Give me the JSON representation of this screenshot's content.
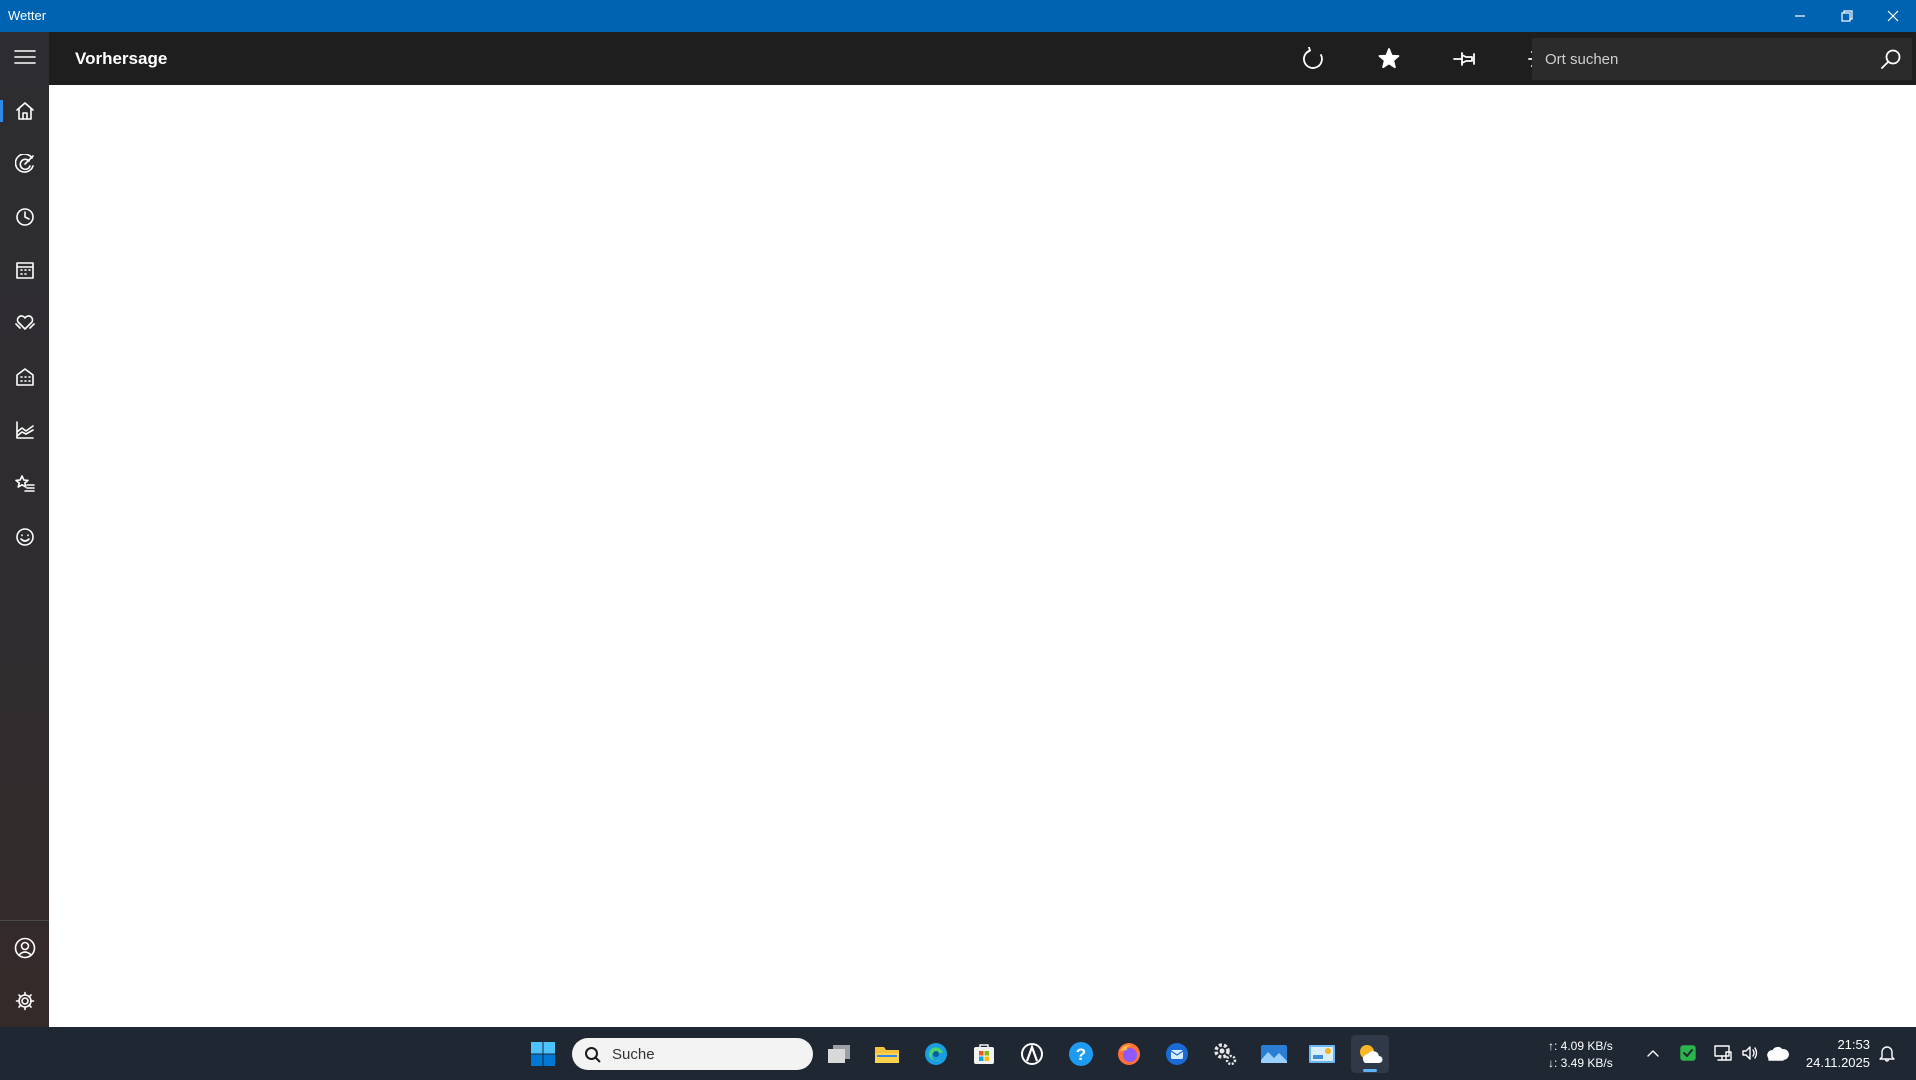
{
  "window": {
    "title": "Wetter",
    "controls": [
      "minimize",
      "restore",
      "close"
    ]
  },
  "header": {
    "title": "Vorhersage",
    "actions": [
      {
        "name": "refresh",
        "icon": "refresh-icon"
      },
      {
        "name": "favorite",
        "icon": "star-icon"
      },
      {
        "name": "pin",
        "icon": "pin-icon"
      },
      {
        "name": "theme",
        "icon": "sun-icon"
      }
    ],
    "search": {
      "placeholder": "Ort suchen",
      "value": ""
    }
  },
  "sidebar": {
    "items": [
      {
        "name": "menu",
        "icon": "hamburger-menu-icon"
      },
      {
        "name": "forecast",
        "icon": "home-icon",
        "active": true
      },
      {
        "name": "maps",
        "icon": "radar-icon"
      },
      {
        "name": "hourly",
        "icon": "clock-icon"
      },
      {
        "name": "monthly",
        "icon": "calendar-icon"
      },
      {
        "name": "life",
        "icon": "heart-hands-icon"
      },
      {
        "name": "buildings",
        "icon": "building-icon"
      },
      {
        "name": "historical",
        "icon": "chart-icon"
      },
      {
        "name": "favorites",
        "icon": "star-list-icon"
      },
      {
        "name": "feedback",
        "icon": "smiley-icon"
      }
    ],
    "bottom": [
      {
        "name": "account",
        "icon": "person-icon"
      },
      {
        "name": "settings",
        "icon": "gear-icon"
      }
    ]
  },
  "taskbar": {
    "search_placeholder": "Suche",
    "apps": [
      "windows-start-icon",
      "task-view-icon",
      "file-explorer-icon",
      "edge-icon",
      "store-icon",
      "app-icon",
      "help-icon",
      "firefox-icon",
      "thunderbird-icon",
      "settings-icon",
      "photos-icon",
      "control-panel-icon",
      "weather-icon"
    ],
    "net_up": "↑: 4.09 KB/s",
    "net_down": "↓: 3.49 KB/s",
    "time": "21:53",
    "date": "24.11.2025"
  },
  "colors": {
    "titlebar": "#0063b1",
    "header": "#1e1e1e",
    "sidebar": "#2d2d31",
    "accent": "#2e8ae6",
    "taskbar": "#1f2733"
  }
}
